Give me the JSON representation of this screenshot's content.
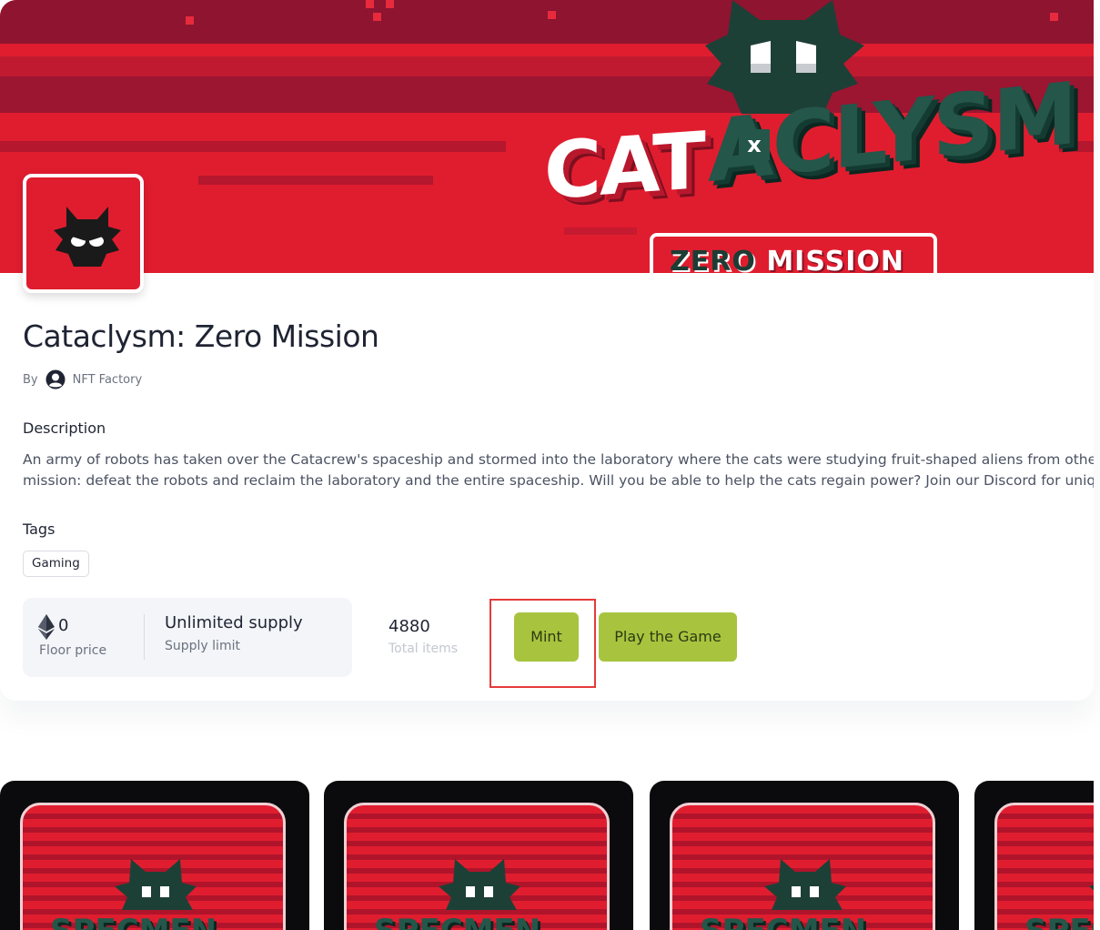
{
  "banner": {
    "logo_part1": "CAT",
    "logo_x": "x",
    "logo_part2": "ACLYSM",
    "subtitle_word1": "ZERO",
    "subtitle_word2": "MISSION"
  },
  "collection": {
    "title": "Cataclysm: Zero Mission",
    "by_label": "By",
    "creator": "NFT Factory",
    "description_label": "Description",
    "description_line1": "An army of robots has taken over the Catacrew's spaceship and stormed into the laboratory where the cats were studying fruit-shaped aliens from othe",
    "description_line2": "mission: defeat the robots and reclaim the laboratory and the entire spaceship. Will you be able to help the cats regain power? Join our Discord for unique",
    "tags_label": "Tags",
    "tags": [
      "Gaming"
    ]
  },
  "stats": {
    "floor_price_value": "0",
    "floor_price_label": "Floor price",
    "supply_value": "Unlimited supply",
    "supply_label": "Supply limit",
    "total_items_value": "4880",
    "total_items_label": "Total items"
  },
  "actions": {
    "mint_label": "Mint",
    "play_label": "Play the Game"
  },
  "thumbnails": {
    "count": 4,
    "label_fragment": "SPECMEN"
  },
  "colors": {
    "banner_red": "#e01d2f",
    "accent_green": "#a8c43f",
    "logo_green": "#24564a",
    "highlight_red": "#e53b3b"
  },
  "icons": [
    "user-circle-icon",
    "ethereum-icon",
    "cat-mascot-icon"
  ]
}
